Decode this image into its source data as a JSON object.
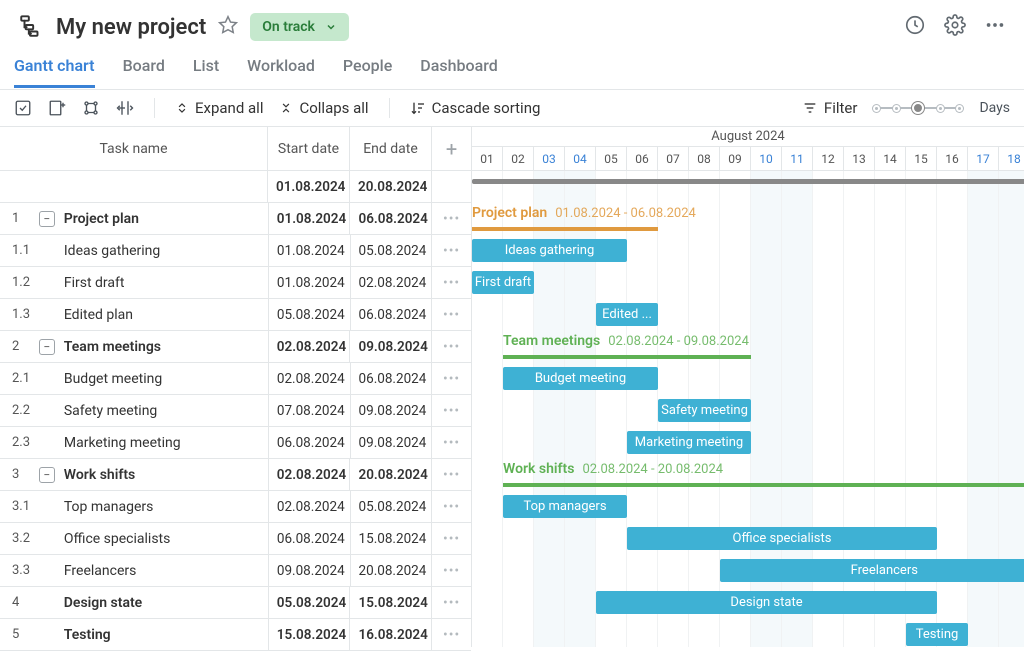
{
  "header": {
    "title": "My new project",
    "status": "On track"
  },
  "tabs": [
    "Gantt chart",
    "Board",
    "List",
    "Workload",
    "People",
    "Dashboard"
  ],
  "toolbar": {
    "expand": "Expand all",
    "collapse": "Collaps all",
    "cascade": "Cascade sorting",
    "filter": "Filter",
    "zoom": "Days"
  },
  "columns": {
    "name": "Task name",
    "start": "Start date",
    "end": "End date"
  },
  "summary": {
    "start": "01.08.2024",
    "end": "20.08.2024"
  },
  "month": "August 2024",
  "days": [
    "01",
    "02",
    "03",
    "04",
    "05",
    "06",
    "07",
    "08",
    "09",
    "10",
    "11",
    "12",
    "13",
    "14",
    "15",
    "16",
    "17",
    "18"
  ],
  "weekend_days": [
    "03",
    "04",
    "10",
    "11",
    "17",
    "18"
  ],
  "tasks": [
    {
      "idx": "1",
      "name": "Project plan",
      "start": "01.08.2024",
      "end": "06.08.2024",
      "parent": true
    },
    {
      "idx": "1.1",
      "name": "Ideas gathering",
      "start": "01.08.2024",
      "end": "05.08.2024"
    },
    {
      "idx": "1.2",
      "name": "First draft",
      "start": "01.08.2024",
      "end": "02.08.2024"
    },
    {
      "idx": "1.3",
      "name": "Edited plan",
      "start": "05.08.2024",
      "end": "06.08.2024"
    },
    {
      "idx": "2",
      "name": "Team meetings",
      "start": "02.08.2024",
      "end": "09.08.2024",
      "parent": true
    },
    {
      "idx": "2.1",
      "name": "Budget meeting",
      "start": "02.08.2024",
      "end": "06.08.2024"
    },
    {
      "idx": "2.2",
      "name": "Safety meeting",
      "start": "07.08.2024",
      "end": "09.08.2024"
    },
    {
      "idx": "2.3",
      "name": "Marketing meeting",
      "start": "06.08.2024",
      "end": "09.08.2024"
    },
    {
      "idx": "3",
      "name": "Work shifts",
      "start": "02.08.2024",
      "end": "20.08.2024",
      "parent": true
    },
    {
      "idx": "3.1",
      "name": "Top managers",
      "start": "02.08.2024",
      "end": "05.08.2024"
    },
    {
      "idx": "3.2",
      "name": "Office specialists",
      "start": "06.08.2024",
      "end": "15.08.2024"
    },
    {
      "idx": "3.3",
      "name": "Freelancers",
      "start": "09.08.2024",
      "end": "20.08.2024"
    },
    {
      "idx": "4",
      "name": "Design state",
      "start": "05.08.2024",
      "end": "15.08.2024",
      "parent": true,
      "nocollapse": true
    },
    {
      "idx": "5",
      "name": "Testing",
      "start": "15.08.2024",
      "end": "16.08.2024",
      "parent": true,
      "nocollapse": true
    }
  ],
  "chart_data": {
    "type": "gantt",
    "month": "August 2024",
    "day_range": [
      1,
      20
    ],
    "groups": [
      {
        "name": "Project plan",
        "color": "#e09a3f",
        "start": 1,
        "end": 6,
        "date_label": "01.08.2024 - 06.08.2024"
      },
      {
        "name": "Team meetings",
        "color": "#5fb154",
        "start": 2,
        "end": 9,
        "date_label": "02.08.2024 - 09.08.2024"
      },
      {
        "name": "Work shifts",
        "color": "#5fb154",
        "start": 2,
        "end": 20,
        "date_label": "02.08.2024 - 20.08.2024"
      }
    ],
    "bars": [
      {
        "row": 1,
        "label": "Ideas gathering",
        "start": 1,
        "end": 5
      },
      {
        "row": 2,
        "label": "First draft",
        "start": 1,
        "end": 2
      },
      {
        "row": 3,
        "label": "Edited ...",
        "start": 5,
        "end": 6
      },
      {
        "row": 5,
        "label": "Budget meeting",
        "start": 2,
        "end": 6
      },
      {
        "row": 6,
        "label": "Safety meeting",
        "start": 7,
        "end": 9
      },
      {
        "row": 7,
        "label": "Marketing meeting",
        "start": 6,
        "end": 9
      },
      {
        "row": 9,
        "label": "Top managers",
        "start": 2,
        "end": 5
      },
      {
        "row": 10,
        "label": "Office specialists",
        "start": 6,
        "end": 15
      },
      {
        "row": 11,
        "label": "Freelancers",
        "start": 9,
        "end": 20
      },
      {
        "row": 12,
        "label": "Design state",
        "start": 5,
        "end": 15
      },
      {
        "row": 13,
        "label": "Testing",
        "start": 15,
        "end": 16
      }
    ]
  }
}
